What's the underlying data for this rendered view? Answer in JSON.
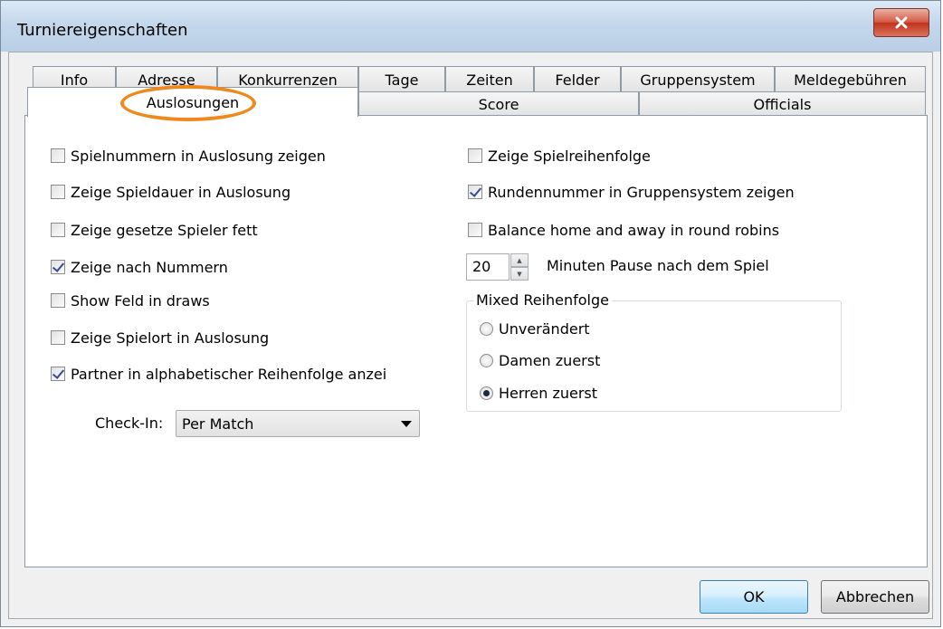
{
  "window": {
    "title": "Turniereigenschaften",
    "close_icon": "close-icon"
  },
  "tabs_row1": [
    "Info",
    "Adresse",
    "Konkurrenzen",
    "Tage",
    "Zeiten",
    "Felder",
    "Gruppensystem",
    "Meldegebühren"
  ],
  "tabs_row2": [
    "Auslosungen",
    "Score",
    "Officials"
  ],
  "active_tab": "Auslosungen",
  "left_options": [
    {
      "label": "Spielnummern in Auslosung zeigen",
      "checked": false
    },
    {
      "label": "Zeige Spieldauer in Auslosung",
      "checked": false
    },
    {
      "label": "Zeige gesetze Spieler fett",
      "checked": false
    },
    {
      "label": "Zeige nach Nummern",
      "checked": true
    },
    {
      "label": "Show Feld in draws",
      "checked": false
    },
    {
      "label": "Zeige Spielort in Auslosung",
      "checked": false
    },
    {
      "label": "Partner in alphabetischer Reihenfolge anzei",
      "checked": true
    }
  ],
  "right_options": [
    {
      "label": "Zeige Spielreihenfolge",
      "checked": false
    },
    {
      "label": "Rundennummer in Gruppensystem zeigen",
      "checked": true
    },
    {
      "label": "Balance home and away in round robins",
      "checked": false
    }
  ],
  "pause": {
    "value": "20",
    "label": "Minuten Pause nach dem Spiel"
  },
  "mixed_group": {
    "title": "Mixed Reihenfolge",
    "options": [
      {
        "label": "Unverändert",
        "selected": false
      },
      {
        "label": "Damen zuerst",
        "selected": false
      },
      {
        "label": "Herren zuerst",
        "selected": true
      }
    ]
  },
  "checkin": {
    "label": "Check-In:",
    "value": "Per Match"
  },
  "buttons": {
    "ok": "OK",
    "cancel": "Abbrechen"
  },
  "colors": {
    "highlight": "#f0891d",
    "check_mark": "#3a4a9a"
  }
}
